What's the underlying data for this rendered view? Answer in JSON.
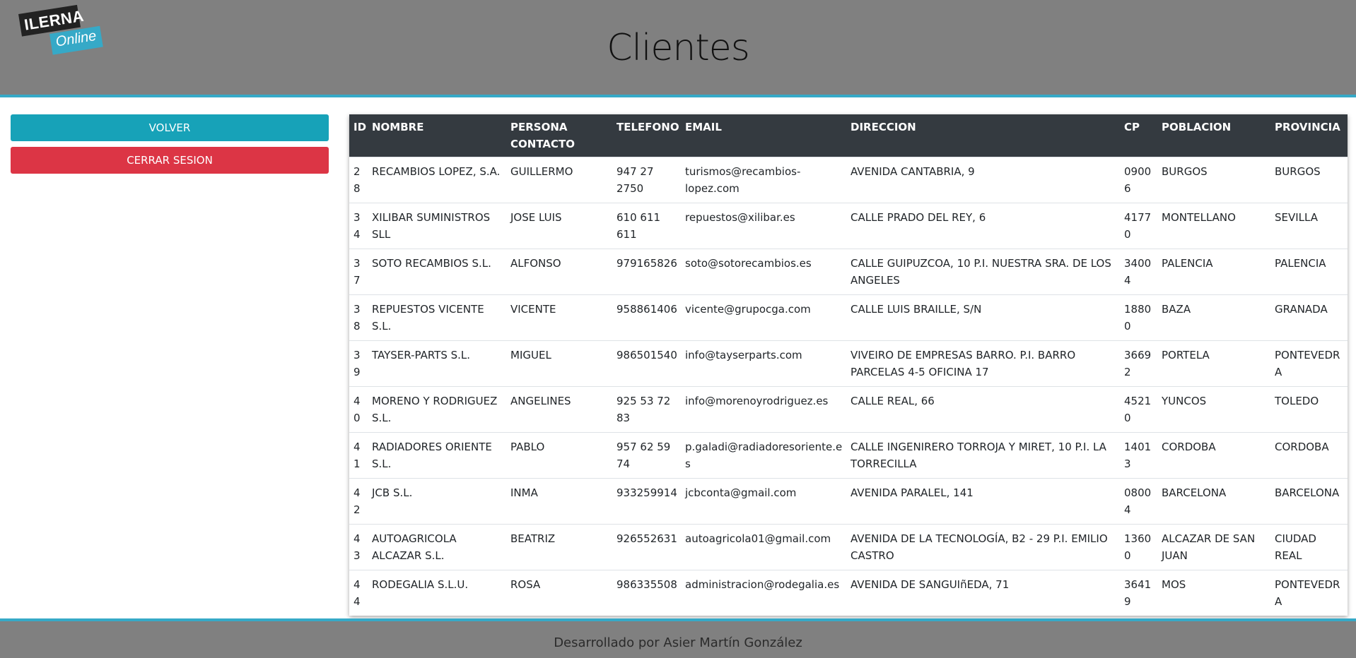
{
  "header": {
    "logo_top": "ILERNA",
    "logo_bottom": "Online",
    "title": "Clientes"
  },
  "sidebar": {
    "volver_label": "VOLVER",
    "cerrar_label": "CERRAR SESION"
  },
  "table": {
    "columns": [
      "ID",
      "NOMBRE",
      "PERSONA CONTACTO",
      "TELEFONO",
      "EMAIL",
      "DIRECCION",
      "CP",
      "POBLACION",
      "PROVINCIA"
    ],
    "rows": [
      [
        "28",
        "RECAMBIOS LOPEZ, S.A.",
        "GUILLERMO",
        "947 27 2750",
        "turismos@recambios-lopez.com",
        "AVENIDA CANTABRIA, 9",
        "09006",
        "BURGOS",
        "BURGOS"
      ],
      [
        "34",
        "XILIBAR SUMINISTROS SLL",
        "JOSE LUIS",
        "610 611 611",
        "repuestos@xilibar.es",
        "CALLE PRADO DEL REY, 6",
        "41770",
        "MONTELLANO",
        "SEVILLA"
      ],
      [
        "37",
        "SOTO RECAMBIOS S.L.",
        "ALFONSO",
        "979165826",
        "soto@sotorecambios.es",
        "CALLE GUIPUZCOA, 10 P.I. NUESTRA SRA. DE LOS ANGELES",
        "34004",
        "PALENCIA",
        "PALENCIA"
      ],
      [
        "38",
        "REPUESTOS VICENTE S.L.",
        "VICENTE",
        "958861406",
        "vicente@grupocga.com",
        "CALLE LUIS BRAILLE, S/N",
        "18800",
        "BAZA",
        "GRANADA"
      ],
      [
        "39",
        "TAYSER-PARTS S.L.",
        "MIGUEL",
        "986501540",
        "info@tayserparts.com",
        "VIVEIRO DE EMPRESAS BARRO. P.I. BARRO PARCELAS 4-5 OFICINA 17",
        "36692",
        "PORTELA",
        "PONTEVEDRA"
      ],
      [
        "40",
        "MORENO Y RODRIGUEZ S.L.",
        "ANGELINES",
        "925 53 72 83",
        "info@morenoyrodriguez.es",
        "CALLE REAL, 66",
        "45210",
        "YUNCOS",
        "TOLEDO"
      ],
      [
        "41",
        "RADIADORES ORIENTE S.L.",
        "PABLO",
        "957 62 59 74",
        "p.galadi@radiadoresoriente.es",
        "CALLE INGENIRERO TORROJA Y MIRET, 10 P.I. LA TORRECILLA",
        "14013",
        "CORDOBA",
        "CORDOBA"
      ],
      [
        "42",
        "JCB S.L.",
        "INMA",
        "933259914",
        "jcbconta@gmail.com",
        "AVENIDA PARALEL, 141",
        "08004",
        "BARCELONA",
        "BARCELONA"
      ],
      [
        "43",
        "AUTOAGRICOLA ALCAZAR S.L.",
        "BEATRIZ",
        "926552631",
        "autoagricola01@gmail.com",
        "AVENIDA DE LA TECNOLOGÍA, B2 - 29 P.I. EMILIO CASTRO",
        "13600",
        "ALCAZAR DE SAN JUAN",
        "CIUDAD REAL"
      ],
      [
        "44",
        "RODEGALIA S.L.U.",
        "ROSA",
        "986335508",
        "administracion@rodegalia.es",
        "AVENIDA DE SANGUIñEDA, 71",
        "36419",
        "MOS",
        "PONTEVEDRA"
      ]
    ]
  },
  "footer": {
    "text": "Desarrollado por Asier Martín González"
  }
}
